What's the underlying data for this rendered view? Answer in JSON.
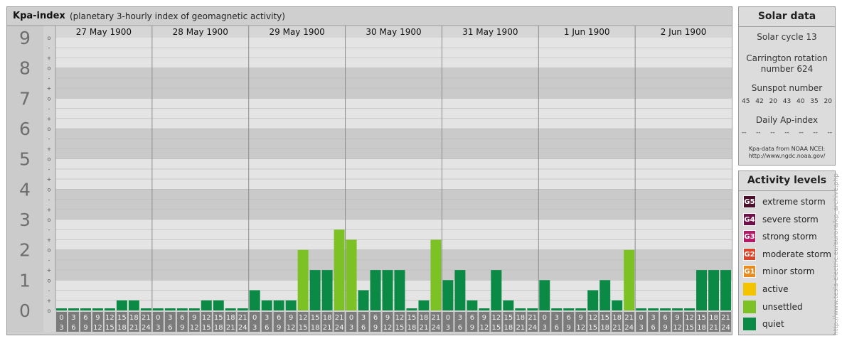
{
  "chart": {
    "title": "Kpa-index",
    "subtitle": "(planetary 3-hourly index of geomagnetic activity)"
  },
  "chart_data": {
    "type": "bar",
    "title": "Kpa-index",
    "subtitle": "(planetary 3-hourly index of geomagnetic activity)",
    "ylim": [
      0,
      9
    ],
    "y_ticks": [
      "0",
      "1",
      "2",
      "3",
      "4",
      "5",
      "6",
      "7",
      "8",
      "9"
    ],
    "minor_ticks": [
      "o",
      "+",
      "-"
    ],
    "days": [
      "27 May 1900",
      "28 May 1900",
      "29 May 1900",
      "30 May 1900",
      "31 May 1900",
      "1 Jun 1900",
      "2 Jun 1900"
    ],
    "hour_start_labels": [
      "0",
      "3",
      "6",
      "9",
      "12",
      "15",
      "18",
      "21"
    ],
    "hour_end_labels": [
      "3",
      "6",
      "9",
      "12",
      "15",
      "18",
      "21",
      "24"
    ],
    "values": [
      [
        0,
        0,
        0,
        0,
        0,
        0.333,
        0.333,
        0
      ],
      [
        0,
        0,
        0,
        0,
        0.333,
        0.333,
        0,
        0
      ],
      [
        0.667,
        0.333,
        0.333,
        0.333,
        2,
        1.333,
        1.333,
        2.667
      ],
      [
        2.333,
        0.667,
        1.333,
        1.333,
        1.333,
        0,
        0.333,
        2.333
      ],
      [
        1,
        1.333,
        0.333,
        0,
        1.333,
        0.333,
        0,
        0
      ],
      [
        1,
        0,
        0,
        0,
        0.667,
        1,
        0.333,
        2
      ],
      [
        0,
        0,
        0,
        0,
        0,
        1.333,
        1.333,
        1.333
      ]
    ],
    "thresholds": {
      "unsettled": 2,
      "active": 4,
      "G1": 5,
      "G2": 6,
      "G3": 7,
      "G4": 8,
      "G5": 9
    },
    "grid": true
  },
  "solar": {
    "title": "Solar data",
    "cycle": "Solar cycle 13",
    "carrington_line1": "Carrington rotation",
    "carrington_line2": "number 624",
    "sunspot_title": "Sunspot number",
    "sunspots": [
      "45",
      "42",
      "20",
      "43",
      "40",
      "35",
      "20"
    ],
    "ap_title": "Daily Ap-index",
    "ap_values": [
      "--",
      "--",
      "--",
      "--",
      "--",
      "--",
      "--"
    ],
    "source_line1": "Kpa-data from NOAA NCEI:",
    "source_line2": "http://www.ngdc.noaa.gov/"
  },
  "activity": {
    "title": "Activity levels",
    "levels": [
      {
        "code": "G5",
        "label": "extreme storm",
        "color": "#4b0f2b"
      },
      {
        "code": "G4",
        "label": "severe storm",
        "color": "#6e1148"
      },
      {
        "code": "G3",
        "label": "strong storm",
        "color": "#b51a66"
      },
      {
        "code": "G2",
        "label": "moderate storm",
        "color": "#d9452a"
      },
      {
        "code": "G1",
        "label": "minor storm",
        "color": "#e78a1f"
      },
      {
        "code": "",
        "label": "active",
        "color": "#f5c400"
      },
      {
        "code": "",
        "label": "unsettled",
        "color": "#7cc225"
      },
      {
        "code": "",
        "label": "quiet",
        "color": "#0a8a44"
      }
    ]
  },
  "watermark": "http://www.tesla-electric.eu/aurora/kp_archive.php"
}
